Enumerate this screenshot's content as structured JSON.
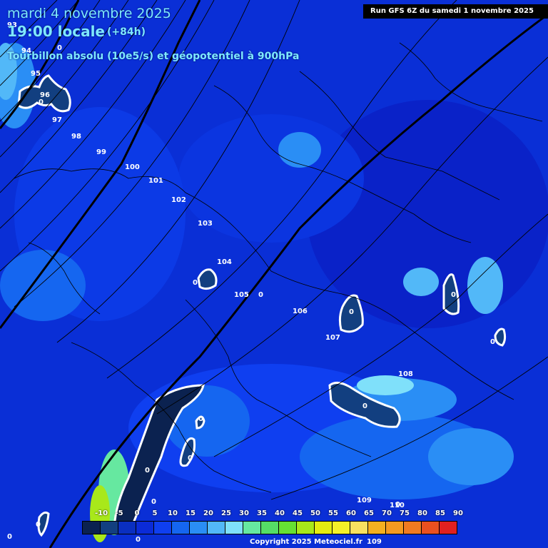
{
  "header": {
    "date": "mardi 4 novembre 2025",
    "time": "19:00 locale",
    "forecast_hours": "(+84h)",
    "title": "Tourbillon absolu (10e5/s) et géopotentiel à 900hPa"
  },
  "run_info": "Run GFS 6Z du samedi 1 novembre 2025",
  "copyright": "Copyright 2025 Meteociel.fr",
  "legend": {
    "labels": [
      "-10",
      "-5",
      "0",
      "5",
      "10",
      "15",
      "20",
      "25",
      "30",
      "35",
      "40",
      "45",
      "50",
      "55",
      "60",
      "65",
      "70",
      "75",
      "80",
      "85",
      "90"
    ],
    "colors": [
      "#0b2250",
      "#123f80",
      "#0a2fc0",
      "#0b2bd8",
      "#0f3ff0",
      "#1566f0",
      "#2a8ef5",
      "#52b8f8",
      "#7fe0fa",
      "#66e8a0",
      "#55dd66",
      "#66e033",
      "#a8e81a",
      "#e4ec10",
      "#f4f028",
      "#f8e060",
      "#f4b020",
      "#f49a20",
      "#f07a20",
      "#ea5020",
      "#e02020"
    ]
  },
  "geopotential_labels": [
    "93",
    "94",
    "95",
    "96",
    "97",
    "98",
    "99",
    "100",
    "101",
    "102",
    "103",
    "104",
    "105",
    "106",
    "107",
    "108",
    "109",
    "110",
    "109"
  ],
  "vorticity_zero_labels": [
    "0",
    "0",
    "0",
    "0",
    "0",
    "0",
    "0",
    "0",
    "0",
    "0",
    "0",
    "0",
    "0",
    "0",
    "0",
    "0"
  ],
  "colors": {
    "background_vorticity": "#0a2fd6",
    "header_text": "#7ee8ff",
    "zero_contour": "#ffffff",
    "isohypse": "#000000"
  }
}
